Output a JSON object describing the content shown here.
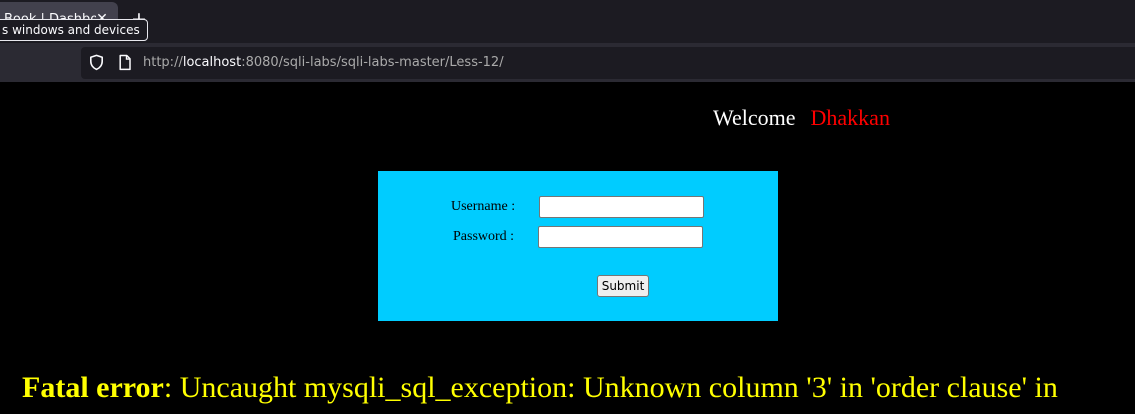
{
  "browser": {
    "tab": {
      "title": "Book | Dashbo",
      "close_glyph": "✕"
    },
    "new_tab_glyph": "+",
    "tooltip": "s windows and devices",
    "address_bar": {
      "url_prefix": "http://",
      "url_host": "localhost",
      "url_rest": ":8080/sqli-labs/sqli-labs-master/Less-12/",
      "shield_icon": "shield-icon",
      "page_icon": "page-icon"
    }
  },
  "page": {
    "welcome": {
      "label": "Welcome",
      "name": "Dhakkan",
      "name_color": "#ff0000"
    },
    "login_form": {
      "background_color": "#00ccff",
      "username_label": "Username :",
      "password_label": "Password :",
      "username_value": "",
      "password_value": "",
      "submit_label": "Submit"
    },
    "error": {
      "label": "Fatal error",
      "message": ": Uncaught mysqli_sql_exception: Unknown column '3' in 'order clause' in",
      "color": "#ffff00"
    }
  }
}
